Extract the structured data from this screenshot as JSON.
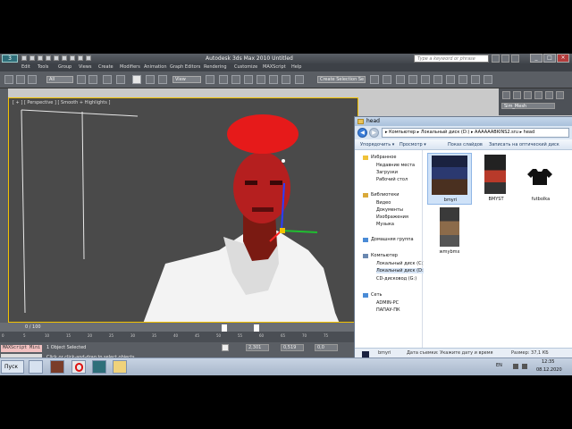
{
  "window": {
    "app_logo": "3",
    "title": "Autodesk 3ds Max  2010      Untitled",
    "search_placeholder": "Type a keyword or phrase",
    "controls": [
      "_",
      "□",
      "×"
    ]
  },
  "menu": [
    "Edit",
    "Tools",
    "Group",
    "Views",
    "Create",
    "Modifiers",
    "Animation",
    "Graph Editors",
    "Rendering",
    "Customize",
    "MAXScript",
    "Help"
  ],
  "toolbar": {
    "filter_dropdown": "All",
    "coord_dropdown": "View",
    "selection_set": "Create Selection Se"
  },
  "viewport": {
    "label": "[ + ] [ Perspective ] [ Smooth + Highlights ]"
  },
  "command_panel": {
    "object_name": "Sim_Mesh"
  },
  "timeline": {
    "frame": "0 / 100",
    "ticks": [
      "0",
      "5",
      "10",
      "15",
      "20",
      "25",
      "30",
      "35",
      "40",
      "45",
      "50",
      "55",
      "60",
      "65",
      "70",
      "75"
    ]
  },
  "status": {
    "script_label": "MAXScript Mini",
    "selection": "1 Object Selected",
    "hint": "Click or click-and-drag to select objects",
    "x": "2,301",
    "y": "0,519",
    "z": "0,0"
  },
  "explorer": {
    "title": "head",
    "path": "▸ Компьютер ▸ Локальный диск (D:) ▸ AAAAAABKINS2.sru ▸ head",
    "commands": [
      "Упорядочить ▾",
      "Просмотр ▾",
      "Показ слайдов",
      "Записать на оптический диск"
    ],
    "nav": {
      "favorites_header": "Избранное",
      "favorites": [
        "Недавние места",
        "Загрузки",
        "Рабочий стол"
      ],
      "libraries_header": "Библиотеки",
      "libraries": [
        "Видео",
        "Документы",
        "Изображения",
        "Музыка"
      ],
      "homegroup": "Домашняя группа",
      "computer_header": "Компьютер",
      "drives": [
        "Локальный диск (C:)",
        "Локальный диск (D:)",
        "CD-дисковод (G:)"
      ],
      "network_header": "Сеть",
      "network": [
        "ADMIN-PC",
        "ПАПАУ-ПК"
      ]
    },
    "files": [
      {
        "name": "bmyri"
      },
      {
        "name": "BMYST"
      },
      {
        "name": "futbolka"
      },
      {
        "name": "wmybmx"
      }
    ],
    "details": {
      "file_name": "bmyri",
      "date_label": "Дата съемки: Укажите дату и время",
      "size_label": "Размер: 37,1 КБ"
    }
  },
  "taskbar": {
    "start": "Пуск",
    "lang": "EN",
    "time": "12:35",
    "date": "08.12.2020"
  }
}
